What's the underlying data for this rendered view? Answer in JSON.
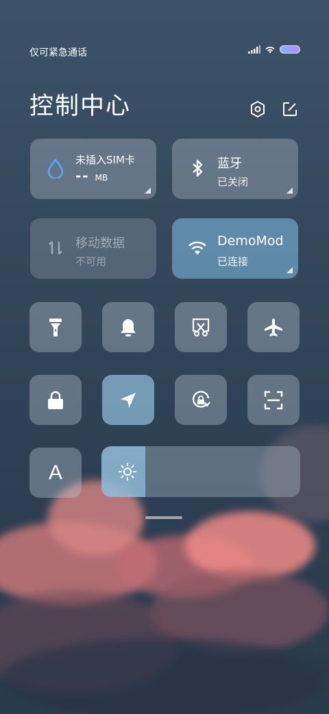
{
  "status_bar": {
    "carrier": "仅可紧急通话"
  },
  "header": {
    "title": "控制中心"
  },
  "tiles": {
    "sim": {
      "title": "未插入SIM卡",
      "value": "--",
      "unit": "MB"
    },
    "bluetooth": {
      "title": "蓝牙",
      "subtitle": "已关闭"
    },
    "mobile_data": {
      "title": "移动数据",
      "subtitle": "不可用"
    },
    "wifi": {
      "title": "DemoMod",
      "subtitle": "已连接"
    }
  },
  "toggles": {
    "row1": [
      "flashlight-icon",
      "bell-icon",
      "screenshot-scissors-icon",
      "airplane-icon"
    ],
    "row2": [
      "lock-icon",
      "location-arrow-icon",
      "rotation-lock-icon",
      "scan-icon"
    ]
  },
  "font_button": {
    "label": "A"
  },
  "brightness": {
    "level": 0.22
  },
  "colors": {
    "accent": "#8cb9d7",
    "battery_start": "#7db2ff",
    "battery_end": "#b98cff"
  }
}
